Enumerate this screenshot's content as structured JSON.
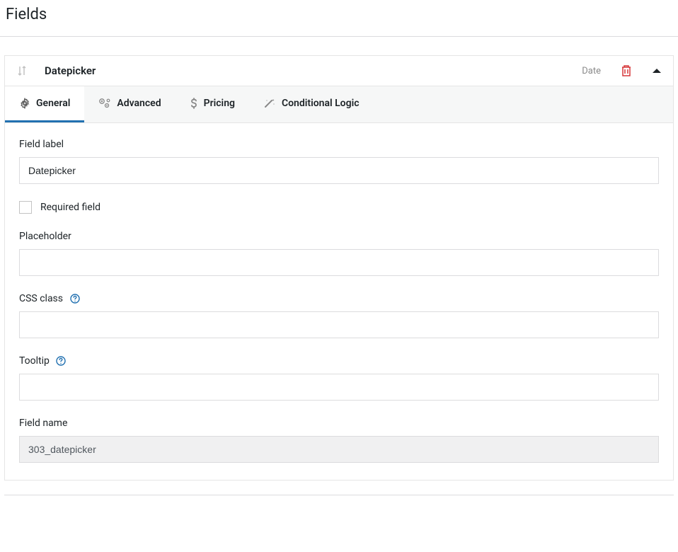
{
  "page": {
    "title": "Fields"
  },
  "field": {
    "title": "Datepicker",
    "type": "Date"
  },
  "tabs": [
    {
      "label": "General"
    },
    {
      "label": "Advanced"
    },
    {
      "label": "Pricing"
    },
    {
      "label": "Conditional Logic"
    }
  ],
  "form": {
    "field_label": {
      "label": "Field label",
      "value": "Datepicker"
    },
    "required": {
      "label": "Required field",
      "checked": false
    },
    "placeholder": {
      "label": "Placeholder",
      "value": ""
    },
    "css_class": {
      "label": "CSS class",
      "value": ""
    },
    "tooltip": {
      "label": "Tooltip",
      "value": ""
    },
    "field_name": {
      "label": "Field name",
      "value": "303_datepicker"
    }
  }
}
